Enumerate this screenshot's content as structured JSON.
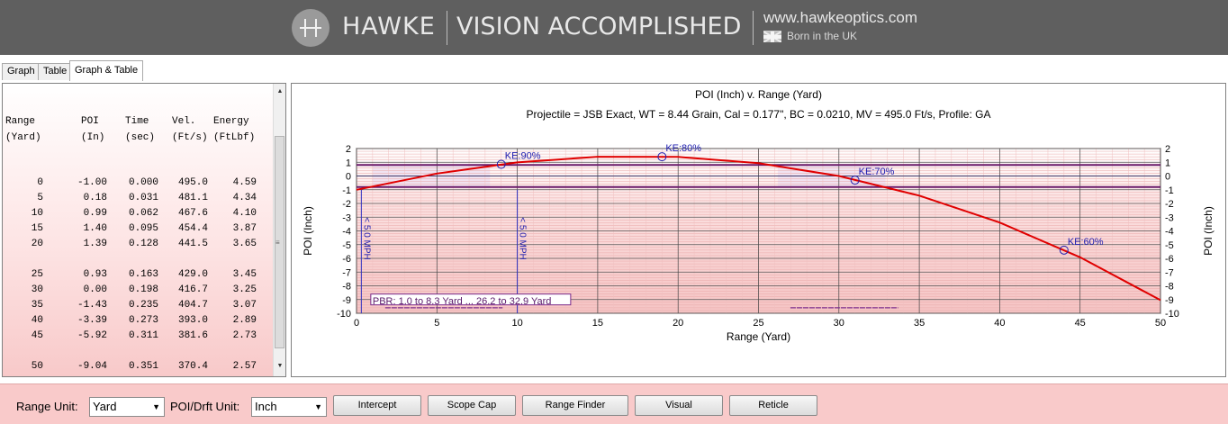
{
  "banner": {
    "brand": "HAWKE",
    "tagline": "VISION ACCOMPLISHED",
    "website": "www.hawkeoptics.com",
    "born": "Born in the UK"
  },
  "tabs": [
    {
      "label": "Graph"
    },
    {
      "label": "Table"
    },
    {
      "label": "Graph & Table"
    }
  ],
  "table": {
    "headers": [
      {
        "top": "Range",
        "bottom": "(Yard)"
      },
      {
        "top": "POI",
        "bottom": "(In)"
      },
      {
        "top": "Time",
        "bottom": "(sec)"
      },
      {
        "top": "Vel.",
        "bottom": "(Ft/s)"
      },
      {
        "top": "Energy",
        "bottom": "(FtLbf)"
      }
    ],
    "rows": [
      [
        "0",
        "-1.00",
        "0.000",
        "495.0",
        "4.59"
      ],
      [
        "5",
        "0.18",
        "0.031",
        "481.1",
        "4.34"
      ],
      [
        "10",
        "0.99",
        "0.062",
        "467.6",
        "4.10"
      ],
      [
        "15",
        "1.40",
        "0.095",
        "454.4",
        "3.87"
      ],
      [
        "20",
        "1.39",
        "0.128",
        "441.5",
        "3.65"
      ],
      [
        "25",
        "0.93",
        "0.163",
        "429.0",
        "3.45"
      ],
      [
        "30",
        "0.00",
        "0.198",
        "416.7",
        "3.25"
      ],
      [
        "35",
        "-1.43",
        "0.235",
        "404.7",
        "3.07"
      ],
      [
        "40",
        "-3.39",
        "0.273",
        "393.0",
        "2.89"
      ],
      [
        "45",
        "-5.92",
        "0.311",
        "381.6",
        "2.73"
      ],
      [
        "50",
        "-9.04",
        "0.351",
        "370.4",
        "2.57"
      ]
    ]
  },
  "chart_data": {
    "type": "line",
    "title": "POI (Inch) v. Range (Yard)",
    "subtitle": "Projectile = JSB Exact, WT = 8.44 Grain, Cal = 0.177\", BC = 0.0210, MV = 495.0 Ft/s, Profile: GA",
    "xlabel": "Range (Yard)",
    "ylabel": "POI (Inch)",
    "y2label": "POI (Inch)",
    "xlim": [
      0,
      50
    ],
    "ylim": [
      -10,
      2
    ],
    "xticks": [
      0,
      5,
      10,
      15,
      20,
      25,
      30,
      35,
      40,
      45,
      50
    ],
    "yticks": [
      2,
      1,
      0,
      -1,
      -2,
      -3,
      -4,
      -5,
      -6,
      -7,
      -8,
      -9,
      -10
    ],
    "grid": true,
    "series": [
      {
        "color": "#e00000",
        "x": [
          0,
          5,
          10,
          15,
          20,
          25,
          30,
          35,
          40,
          45,
          50
        ],
        "y": [
          -1.0,
          0.18,
          0.99,
          1.4,
          1.39,
          0.93,
          0.0,
          -1.43,
          -3.39,
          -5.92,
          -9.04
        ]
      }
    ],
    "ke_markers": [
      {
        "label": "KE:90%",
        "x": 9,
        "y": 0.85
      },
      {
        "label": "KE:80%",
        "x": 19,
        "y": 1.4
      },
      {
        "label": "KE:70%",
        "x": 31,
        "y": -0.3
      },
      {
        "label": "KE:60%",
        "x": 44,
        "y": -5.4
      }
    ],
    "kill_zone": {
      "top": 0.8,
      "bottom": -0.8
    },
    "wind_markers": [
      {
        "label": "< 5.0 MPH",
        "x": 0.3
      },
      {
        "label": "< 5.0 MPH",
        "x": 10
      }
    ],
    "pbr_label": "PBR: 1.0 to 8.3 Yard ... 26.2 to 32.9 Yard",
    "pbr_ranges": [
      [
        1.0,
        8.3
      ],
      [
        26.2,
        32.9
      ]
    ]
  },
  "toolbar": {
    "range_unit_label": "Range Unit:",
    "range_unit_value": "Yard",
    "poi_unit_label": "POI/Drft Unit:",
    "poi_unit_value": "Inch",
    "buttons": [
      "Intercept",
      "Scope Cap",
      "Range Finder",
      "Visual",
      "Reticle"
    ]
  },
  "colors": {
    "banner": "#5f5f5f",
    "toolbar": "#f9caca",
    "curve": "#e00000",
    "kill_zone_line": "#6a1a6a",
    "marker": "#2020b0"
  }
}
